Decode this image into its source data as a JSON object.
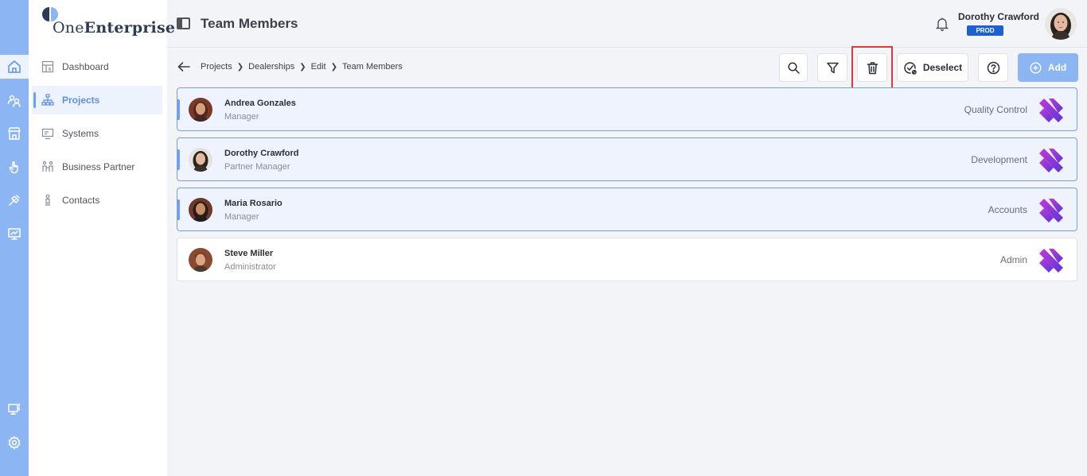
{
  "app": {
    "logo_prefix": "One",
    "logo_suffix": "Enterprise"
  },
  "rail": {
    "items": [
      "home-icon",
      "users-icon",
      "store-icon",
      "touch-icon",
      "tools-icon",
      "monitor-chart-icon"
    ],
    "bottom": [
      "remote-monitor-icon",
      "settings-icon"
    ]
  },
  "sidebar": {
    "items": [
      {
        "label": "Dashboard",
        "icon": "dashboard-icon"
      },
      {
        "label": "Projects",
        "icon": "hierarchy-icon"
      },
      {
        "label": "Systems",
        "icon": "systems-icon"
      },
      {
        "label": "Business Partner",
        "icon": "partners-icon"
      },
      {
        "label": "Contacts",
        "icon": "person-icon"
      }
    ]
  },
  "header": {
    "title": "Team Members",
    "user_name": "Dorothy Crawford",
    "environment": "PROD"
  },
  "breadcrumb": [
    "Projects",
    "Dealerships",
    "Edit",
    "Team Members"
  ],
  "toolbar": {
    "deselect_label": "Deselect",
    "add_label": "Add"
  },
  "members": [
    {
      "name": "Andrea Gonzales",
      "role": "Manager",
      "department": "Quality Control",
      "selected": true
    },
    {
      "name": "Dorothy Crawford",
      "role": "Partner Manager",
      "department": "Development",
      "selected": true
    },
    {
      "name": "Maria Rosario",
      "role": "Manager",
      "department": "Accounts",
      "selected": true
    },
    {
      "name": "Steve Miller",
      "role": "Administrator",
      "department": "Admin",
      "selected": false
    }
  ],
  "colors": {
    "accent": "#8cb5f4",
    "accent_dark": "#5d8fe4",
    "badge": "#1d5fd6",
    "highlight": "#e0393e",
    "logo_purple": "#a23be0"
  }
}
